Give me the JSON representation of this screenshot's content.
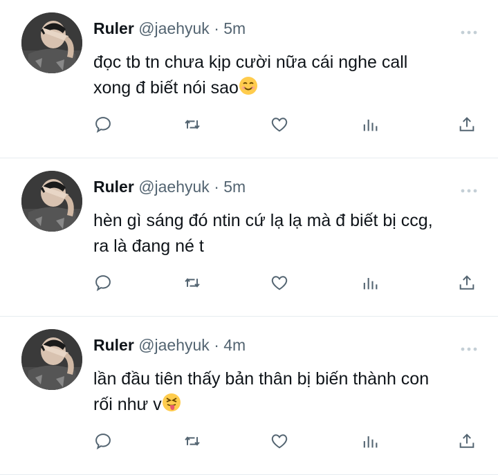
{
  "tweets": [
    {
      "name": "Ruler",
      "handle": "@jaehyuk",
      "separator": " · ",
      "time": "5m",
      "lines": [
        "đọc tb tn chưa kịp cười nữa cái nghe call",
        "xong đ biết nói sao"
      ],
      "emoji": "smiling-face-with-smiling-eyes"
    },
    {
      "name": "Ruler",
      "handle": "@jaehyuk",
      "separator": " · ",
      "time": "5m",
      "lines": [
        "hèn gì sáng đó ntin cứ lạ lạ mà đ biết bị ccg,",
        "ra là đang né t"
      ],
      "emoji": ""
    },
    {
      "name": "Ruler",
      "handle": "@jaehyuk",
      "separator": " · ",
      "time": "4m",
      "lines": [
        "lần đầu tiên thấy bản thân bị biến thành con",
        "rối như v"
      ],
      "emoji": "squinting-face-with-tongue"
    }
  ],
  "icons": {
    "reply": "reply-icon",
    "retweet": "retweet-icon",
    "like": "like-icon",
    "analytics": "analytics-icon",
    "share": "share-icon",
    "more": "more-icon"
  },
  "colors": {
    "text": "#0f1419",
    "secondary": "#536471",
    "divider": "#e6ecf0",
    "emoji": "#ffcc4d"
  }
}
